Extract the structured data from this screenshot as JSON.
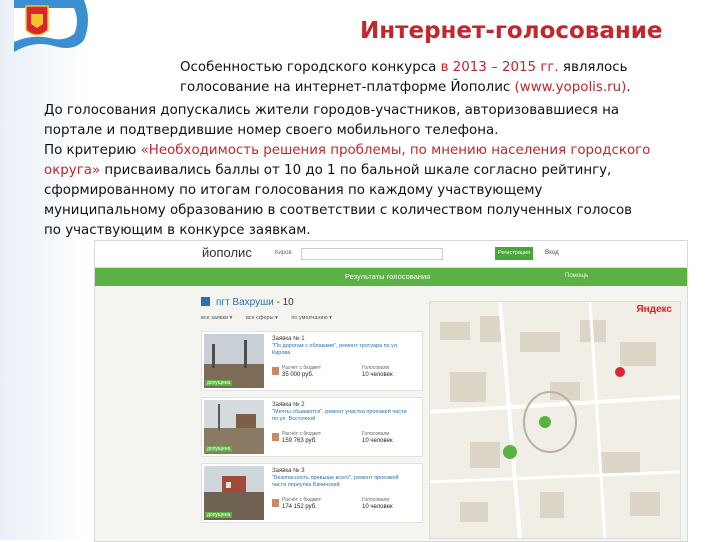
{
  "slide": {
    "title": "Интернет-голосование",
    "intro_lines": [
      [
        "Особенностью городского конкурса ",
        "в 2013 – 2015 гг.",
        " являлось"
      ],
      [
        "голосование на интернет-платформе Йополис ",
        "(www.yopolis.ru)",
        "."
      ]
    ],
    "body_lines": [
      [
        [
          "До голосования допускались жители городов-участников, авторизовавшиеся на",
          false
        ]
      ],
      [
        [
          "портале и подтвердившие номер своего мобильного телефона.",
          false
        ]
      ],
      [
        [
          "По критерию ",
          false
        ],
        [
          "«Необходимость решения проблемы, по мнению населения городского",
          true
        ]
      ],
      [
        [
          "округа»",
          true
        ],
        [
          " присваивались баллы от 10 до 1 по бальной шкале согласно рейтингу,",
          false
        ]
      ],
      [
        [
          "сформированному по итогам голосования по каждому участвующему",
          false
        ]
      ],
      [
        [
          "муниципальному образованию в соответствии с количеством полученных голосов",
          false
        ]
      ],
      [
        [
          "по участвующим в конкурсе заявкам.",
          false
        ]
      ]
    ]
  },
  "screenshot": {
    "logo": "йополис",
    "city": "Киров",
    "register": "Регистрация",
    "login": "Вход",
    "results": "Результаты голосования",
    "help": "Помощь",
    "heading_place": "пгт Вахруши",
    "heading_count": "- 10",
    "filters": [
      "все заявки ▾",
      "все сферы ▾",
      "по умолчанию ▾"
    ],
    "cards": [
      {
        "num": "Заявка № 1",
        "desc": "\"По дорогам с облаками\", ремонт тротуара по ул. Кирова",
        "cost_label": "Расчёт с бюджет",
        "cost": "35 000 руб.",
        "votes_label": "Голосовали",
        "votes": "10 человек",
        "tag": "допущена"
      },
      {
        "num": "Заявка № 2",
        "desc": "\"Мечты сбываются\", ремонт участка проезжей части по ул. Восточной",
        "cost_label": "Расчёт с бюджет",
        "cost": "159 763 руб.",
        "votes_label": "Голосовали",
        "votes": "10 человек",
        "tag": "допущена"
      },
      {
        "num": "Заявка № 3",
        "desc": "\"Безопасность превыше всего\", ремонт проезжей части переулка Бачинский",
        "cost_label": "Расчёт с бюджет",
        "cost": "174 152 руб.",
        "votes_label": "Голосовали",
        "votes": "10 человек",
        "tag": "допущена"
      }
    ],
    "map_logo": "Яндекс"
  }
}
